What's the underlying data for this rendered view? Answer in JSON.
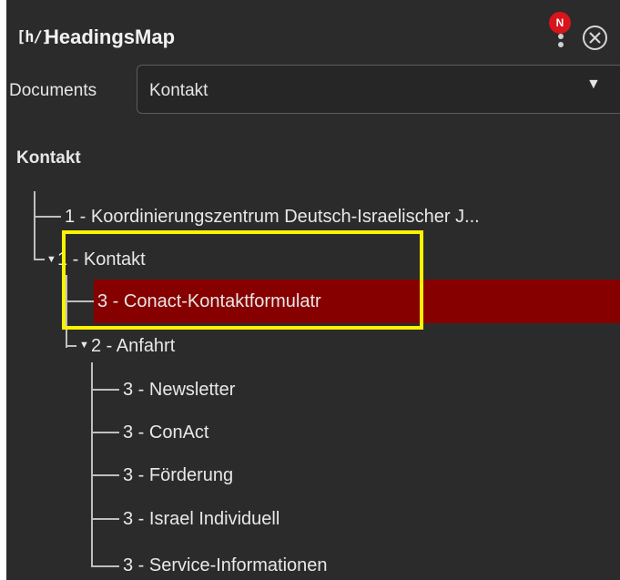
{
  "app": {
    "logo_text": "[h/]",
    "title": "HeadingsMap",
    "notification_badge": "N"
  },
  "documents": {
    "label": "Documents",
    "selected": "Kontakt"
  },
  "tree": {
    "title": "Kontakt",
    "nodes": [
      {
        "label": "1 - Koordinierungszentrum Deutsch-Israelischer J..."
      },
      {
        "label": "1 -  Kontakt"
      },
      {
        "label": "3 - Conact-Kontaktformulatr"
      },
      {
        "label": "2 - Anfahrt"
      },
      {
        "label": "3 - Newsletter"
      },
      {
        "label": "3 - ConAct"
      },
      {
        "label": "3 - Förderung"
      },
      {
        "label": "3 - Israel Individuell"
      },
      {
        "label": "3 - Service-Informationen"
      }
    ]
  },
  "colors": {
    "panel_bg": "#2b2b2b",
    "selected_bg": "#870000",
    "highlight_border": "#fff200",
    "badge_bg": "#d8141c"
  }
}
